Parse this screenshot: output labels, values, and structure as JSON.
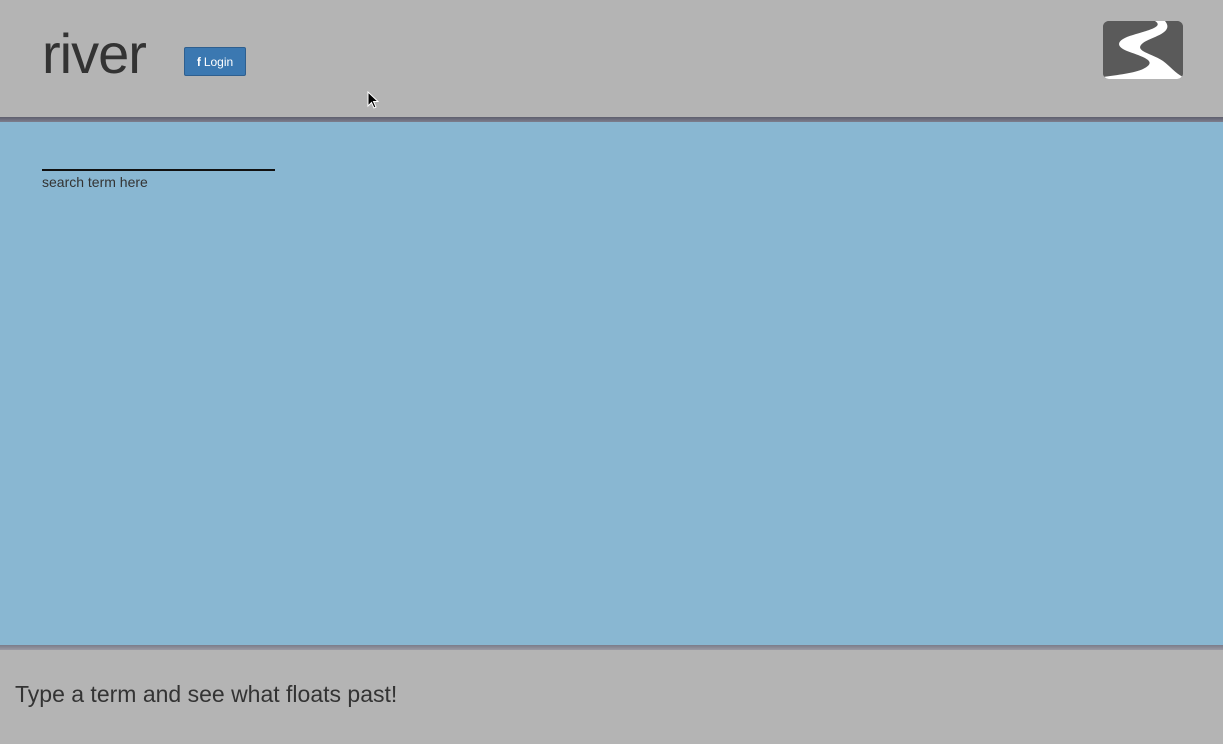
{
  "header": {
    "title": "river",
    "login_label": "Login",
    "login_icon": "f",
    "logo_icon": "river-logo-icon"
  },
  "search": {
    "value": "",
    "placeholder": "",
    "hint": "search term here"
  },
  "footer": {
    "tagline": "Type a term and see what floats past!"
  },
  "colors": {
    "header_bg": "#b4b4b4",
    "river_bg": "#89b7d2",
    "login_bg": "#3b78b1",
    "logo_bg": "#5a5a5a",
    "text": "#333333"
  }
}
